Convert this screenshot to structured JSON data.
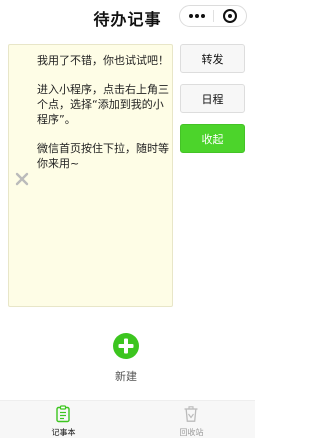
{
  "navbar": {
    "title": "待办记事",
    "more_icon": "more-dots-icon",
    "close_icon": "target-close-icon"
  },
  "note": {
    "delete_icon": "close-x-icon",
    "paragraphs": [
      "我用了不错，你也试试吧！",
      "进入小程序，点击右上角三个点，选择“添加到我的小程序”。",
      "微信首页按住下拉，随时等你来用~"
    ]
  },
  "actions": {
    "forward_label": "转发",
    "schedule_label": "日程",
    "collapse_label": "收起"
  },
  "new_note": {
    "icon": "plus-circle-icon",
    "label": "新建"
  },
  "tabbar": {
    "tabs": [
      {
        "label": "记事本",
        "icon": "notepad-icon",
        "active": true
      },
      {
        "label": "回收站",
        "icon": "trash-icon",
        "active": false
      }
    ]
  },
  "colors": {
    "accent_green": "#4cd42b",
    "note_background": "#fefde6",
    "tabbar_background": "#f7f7f7"
  }
}
